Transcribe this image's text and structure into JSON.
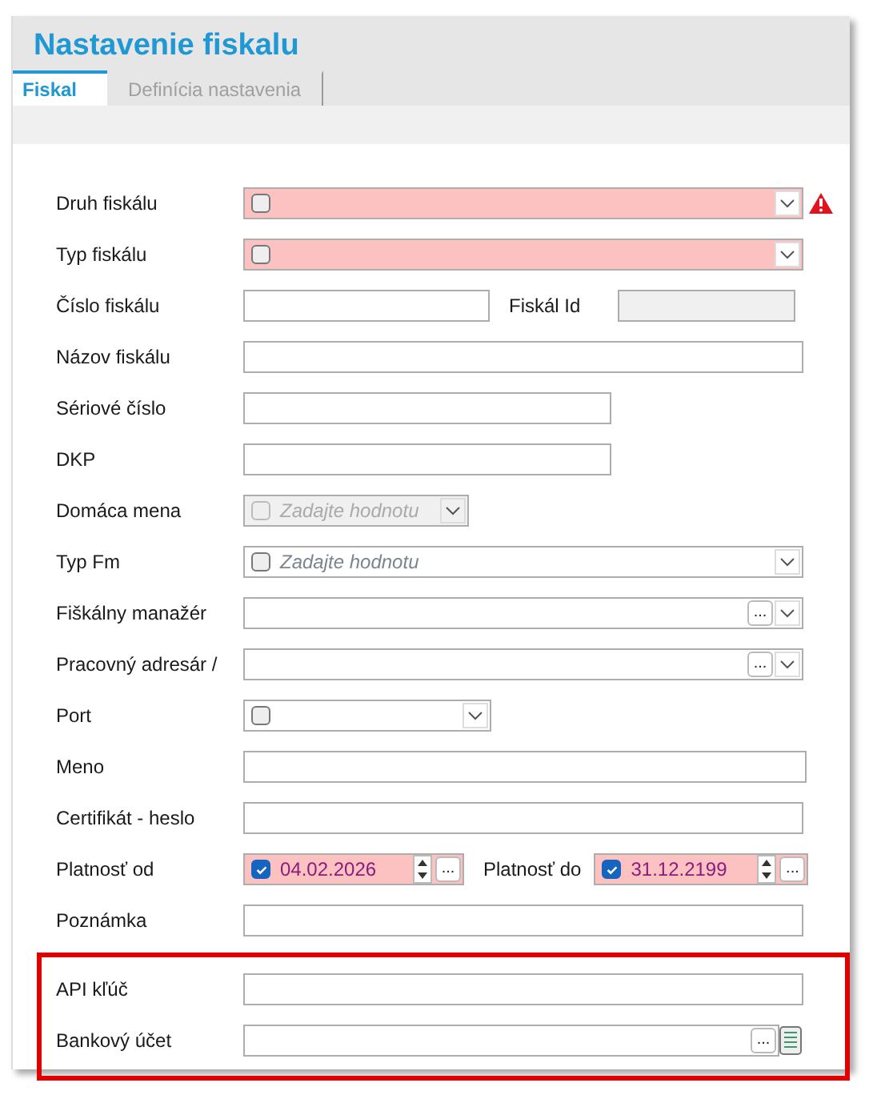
{
  "window": {
    "title": "Nastavenie fiskalu"
  },
  "tabs": [
    {
      "label": "Fiskal",
      "selected": true
    },
    {
      "label": "Definícia nastavenia",
      "selected": false
    }
  ],
  "fields": [
    {
      "label": "Druh fiskálu",
      "kind": "combo",
      "checked": false,
      "error": true,
      "warning": true
    },
    {
      "label": "Typ fiskálu",
      "kind": "combo",
      "checked": false,
      "error": true,
      "warning": false
    },
    {
      "label": "Číslo fiskálu",
      "kind": "text",
      "pair": {
        "label": "Fiskál Id",
        "kind": "text",
        "disabled": true
      }
    },
    {
      "label": "Názov fiskálu",
      "kind": "text"
    },
    {
      "label": "Sériové číslo",
      "kind": "text"
    },
    {
      "label": "DKP",
      "kind": "text"
    },
    {
      "label": "Domáca mena",
      "kind": "combo",
      "checked": false,
      "disabled": true,
      "placeholder": "Zadajte hodnotu"
    },
    {
      "label": "Typ Fm",
      "kind": "combo",
      "checked": false,
      "placeholder": "Zadajte hodnotu"
    },
    {
      "label": "Fiškálny manažér",
      "kind": "lookup",
      "button": "..."
    },
    {
      "label": "Pracovný adresár /",
      "kind": "lookup",
      "button": "..."
    },
    {
      "label": "Port",
      "kind": "combo",
      "checked": false
    },
    {
      "label": "Meno",
      "kind": "text"
    },
    {
      "label": "Certifikát - heslo",
      "kind": "text"
    },
    {
      "label": "Platnosť od",
      "kind": "date",
      "checked": true,
      "error": true,
      "value": "04.02.2026",
      "button": "...",
      "pair": {
        "label": "Platnosť do",
        "kind": "date",
        "checked": true,
        "error": true,
        "value": "31.12.2199",
        "button": "..."
      }
    },
    {
      "label": "Poznámka",
      "kind": "text"
    },
    {
      "label": "API kľúč",
      "kind": "text",
      "highlighted": true
    },
    {
      "label": "Bankový účet",
      "kind": "browse",
      "button": "...",
      "highlighted": true
    }
  ]
}
